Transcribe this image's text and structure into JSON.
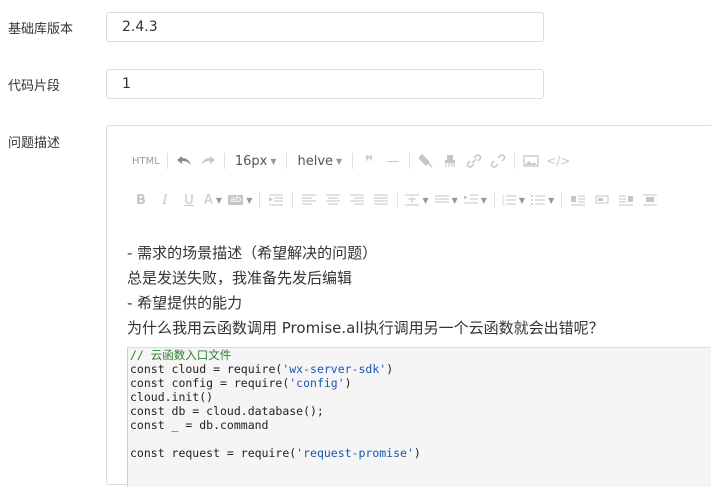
{
  "form": {
    "lib_version_label": "基础库版本",
    "lib_version_value": "2.4.3",
    "snippet_label": "代码片段",
    "snippet_value": "1",
    "description_label": "问题描述"
  },
  "toolbar": {
    "html_label": "HTML",
    "font_size": "16px",
    "font_family": "helve"
  },
  "content": {
    "lines": [
      "- 需求的场景描述（希望解决的问题）",
      "总是发送失败，我准备先发后编辑",
      "- 希望提供的能力",
      "为什么我用云函数调用 Promise.all执行调用另一个云函数就会出错呢？"
    ]
  },
  "code": {
    "comment": "// 云函数入口文件",
    "l1_pre": "const cloud = require(",
    "l1_str": "'wx-server-sdk'",
    "l1_post": ")",
    "l2_pre": "const config = require(",
    "l2_str": "'config'",
    "l2_post": ")",
    "l3": "cloud.init()",
    "l4": "const db = cloud.database();",
    "l5": "const _ = db.command",
    "l6_pre": "const request = require(",
    "l6_str": "'request-promise'",
    "l6_post": ")"
  }
}
